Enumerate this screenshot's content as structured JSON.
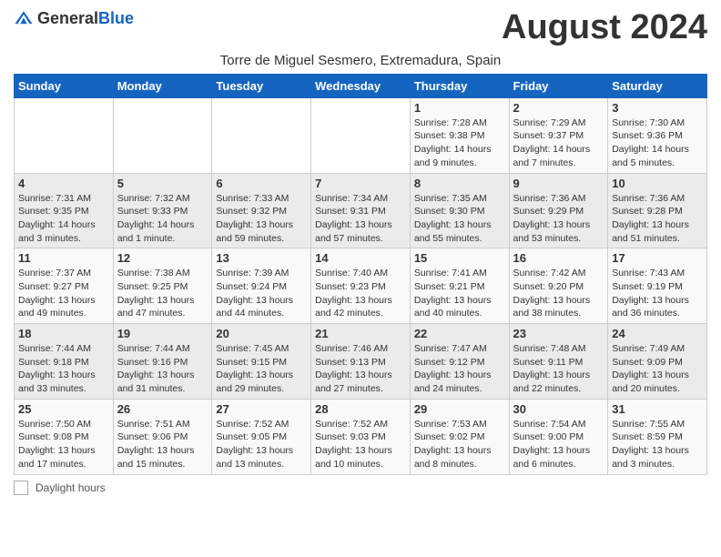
{
  "header": {
    "logo_general": "General",
    "logo_blue": "Blue",
    "month_title": "August 2024",
    "subtitle": "Torre de Miguel Sesmero, Extremadura, Spain"
  },
  "days_of_week": [
    "Sunday",
    "Monday",
    "Tuesday",
    "Wednesday",
    "Thursday",
    "Friday",
    "Saturday"
  ],
  "weeks": [
    [
      {
        "num": "",
        "info": ""
      },
      {
        "num": "",
        "info": ""
      },
      {
        "num": "",
        "info": ""
      },
      {
        "num": "",
        "info": ""
      },
      {
        "num": "1",
        "info": "Sunrise: 7:28 AM\nSunset: 9:38 PM\nDaylight: 14 hours\nand 9 minutes."
      },
      {
        "num": "2",
        "info": "Sunrise: 7:29 AM\nSunset: 9:37 PM\nDaylight: 14 hours\nand 7 minutes."
      },
      {
        "num": "3",
        "info": "Sunrise: 7:30 AM\nSunset: 9:36 PM\nDaylight: 14 hours\nand 5 minutes."
      }
    ],
    [
      {
        "num": "4",
        "info": "Sunrise: 7:31 AM\nSunset: 9:35 PM\nDaylight: 14 hours\nand 3 minutes."
      },
      {
        "num": "5",
        "info": "Sunrise: 7:32 AM\nSunset: 9:33 PM\nDaylight: 14 hours\nand 1 minute."
      },
      {
        "num": "6",
        "info": "Sunrise: 7:33 AM\nSunset: 9:32 PM\nDaylight: 13 hours\nand 59 minutes."
      },
      {
        "num": "7",
        "info": "Sunrise: 7:34 AM\nSunset: 9:31 PM\nDaylight: 13 hours\nand 57 minutes."
      },
      {
        "num": "8",
        "info": "Sunrise: 7:35 AM\nSunset: 9:30 PM\nDaylight: 13 hours\nand 55 minutes."
      },
      {
        "num": "9",
        "info": "Sunrise: 7:36 AM\nSunset: 9:29 PM\nDaylight: 13 hours\nand 53 minutes."
      },
      {
        "num": "10",
        "info": "Sunrise: 7:36 AM\nSunset: 9:28 PM\nDaylight: 13 hours\nand 51 minutes."
      }
    ],
    [
      {
        "num": "11",
        "info": "Sunrise: 7:37 AM\nSunset: 9:27 PM\nDaylight: 13 hours\nand 49 minutes."
      },
      {
        "num": "12",
        "info": "Sunrise: 7:38 AM\nSunset: 9:25 PM\nDaylight: 13 hours\nand 47 minutes."
      },
      {
        "num": "13",
        "info": "Sunrise: 7:39 AM\nSunset: 9:24 PM\nDaylight: 13 hours\nand 44 minutes."
      },
      {
        "num": "14",
        "info": "Sunrise: 7:40 AM\nSunset: 9:23 PM\nDaylight: 13 hours\nand 42 minutes."
      },
      {
        "num": "15",
        "info": "Sunrise: 7:41 AM\nSunset: 9:21 PM\nDaylight: 13 hours\nand 40 minutes."
      },
      {
        "num": "16",
        "info": "Sunrise: 7:42 AM\nSunset: 9:20 PM\nDaylight: 13 hours\nand 38 minutes."
      },
      {
        "num": "17",
        "info": "Sunrise: 7:43 AM\nSunset: 9:19 PM\nDaylight: 13 hours\nand 36 minutes."
      }
    ],
    [
      {
        "num": "18",
        "info": "Sunrise: 7:44 AM\nSunset: 9:18 PM\nDaylight: 13 hours\nand 33 minutes."
      },
      {
        "num": "19",
        "info": "Sunrise: 7:44 AM\nSunset: 9:16 PM\nDaylight: 13 hours\nand 31 minutes."
      },
      {
        "num": "20",
        "info": "Sunrise: 7:45 AM\nSunset: 9:15 PM\nDaylight: 13 hours\nand 29 minutes."
      },
      {
        "num": "21",
        "info": "Sunrise: 7:46 AM\nSunset: 9:13 PM\nDaylight: 13 hours\nand 27 minutes."
      },
      {
        "num": "22",
        "info": "Sunrise: 7:47 AM\nSunset: 9:12 PM\nDaylight: 13 hours\nand 24 minutes."
      },
      {
        "num": "23",
        "info": "Sunrise: 7:48 AM\nSunset: 9:11 PM\nDaylight: 13 hours\nand 22 minutes."
      },
      {
        "num": "24",
        "info": "Sunrise: 7:49 AM\nSunset: 9:09 PM\nDaylight: 13 hours\nand 20 minutes."
      }
    ],
    [
      {
        "num": "25",
        "info": "Sunrise: 7:50 AM\nSunset: 9:08 PM\nDaylight: 13 hours\nand 17 minutes."
      },
      {
        "num": "26",
        "info": "Sunrise: 7:51 AM\nSunset: 9:06 PM\nDaylight: 13 hours\nand 15 minutes."
      },
      {
        "num": "27",
        "info": "Sunrise: 7:52 AM\nSunset: 9:05 PM\nDaylight: 13 hours\nand 13 minutes."
      },
      {
        "num": "28",
        "info": "Sunrise: 7:52 AM\nSunset: 9:03 PM\nDaylight: 13 hours\nand 10 minutes."
      },
      {
        "num": "29",
        "info": "Sunrise: 7:53 AM\nSunset: 9:02 PM\nDaylight: 13 hours\nand 8 minutes."
      },
      {
        "num": "30",
        "info": "Sunrise: 7:54 AM\nSunset: 9:00 PM\nDaylight: 13 hours\nand 6 minutes."
      },
      {
        "num": "31",
        "info": "Sunrise: 7:55 AM\nSunset: 8:59 PM\nDaylight: 13 hours\nand 3 minutes."
      }
    ]
  ],
  "footer": {
    "legend_label": "Daylight hours"
  }
}
